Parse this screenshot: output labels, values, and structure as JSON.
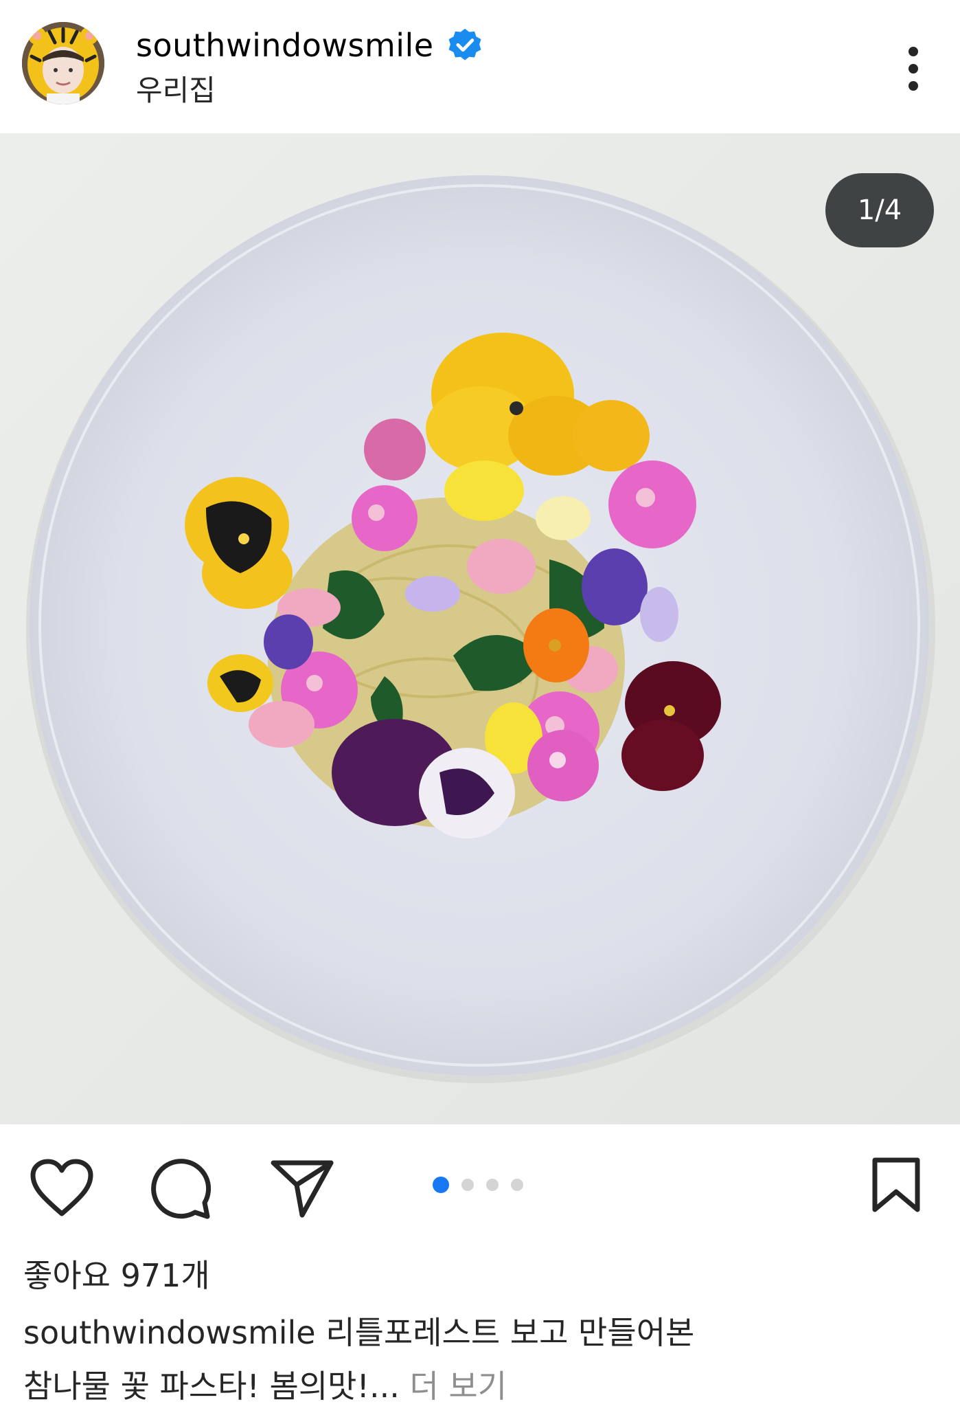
{
  "post": {
    "username": "southwindowsmile",
    "location": "우리집",
    "verified": true,
    "media_counter": "1/4",
    "carousel": {
      "total": 4,
      "active": 1
    },
    "likes_text": "좋아요 971개",
    "caption_user": "southwindowsmile",
    "caption_text_line1": "리틀포레스트 보고 만들어본",
    "caption_text_line2": "참나물 꽃 파스타! 봄의맛!...",
    "more_label": "더 보기"
  },
  "icons": {
    "like": "heart-icon",
    "comment": "comment-bubble-icon",
    "share": "send-paper-plane-icon",
    "save": "bookmark-icon",
    "more": "vertical-dots-icon",
    "verified": "verified-badge-icon"
  },
  "colors": {
    "verified_blue": "#1a8cf0",
    "active_dot": "#1877f2",
    "counter_bg": "#3f4344"
  }
}
